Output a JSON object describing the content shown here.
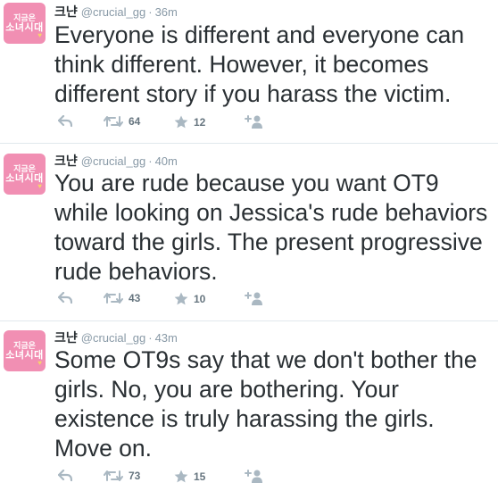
{
  "tweets": [
    {
      "avatar": {
        "line1": "지금은",
        "line2": "소녀시대",
        "mark": "♥"
      },
      "name": "크냔",
      "handle": "@crucial_gg",
      "separator": "·",
      "time": "36m",
      "text": "Everyone is different and everyone can think different. However, it becomes different story if you harass the victim.",
      "retweets": "64",
      "favorites": "12"
    },
    {
      "avatar": {
        "line1": "지금은",
        "line2": "소녀시대",
        "mark": "♥"
      },
      "name": "크냔",
      "handle": "@crucial_gg",
      "separator": "·",
      "time": "40m",
      "text": "You are rude because you want OT9 while looking on Jessica's rude behaviors toward the girls. The present progressive rude behaviors.",
      "retweets": "43",
      "favorites": "10"
    },
    {
      "avatar": {
        "line1": "지금은",
        "line2": "소녀시대",
        "mark": "♥"
      },
      "name": "크냔",
      "handle": "@crucial_gg",
      "separator": "·",
      "time": "43m",
      "text": "Some OT9s say that we don't bother the girls. No, you are bothering. Your existence is truly harassing the girls. Move on.",
      "retweets": "73",
      "favorites": "15"
    }
  ],
  "colors": {
    "avatar_bg": "#f18fb3",
    "muted": "#8899a6",
    "text": "#292f33",
    "divider": "#e1e8ed"
  },
  "icons": [
    "reply-icon",
    "retweet-icon",
    "favorite-icon",
    "follow-icon"
  ]
}
